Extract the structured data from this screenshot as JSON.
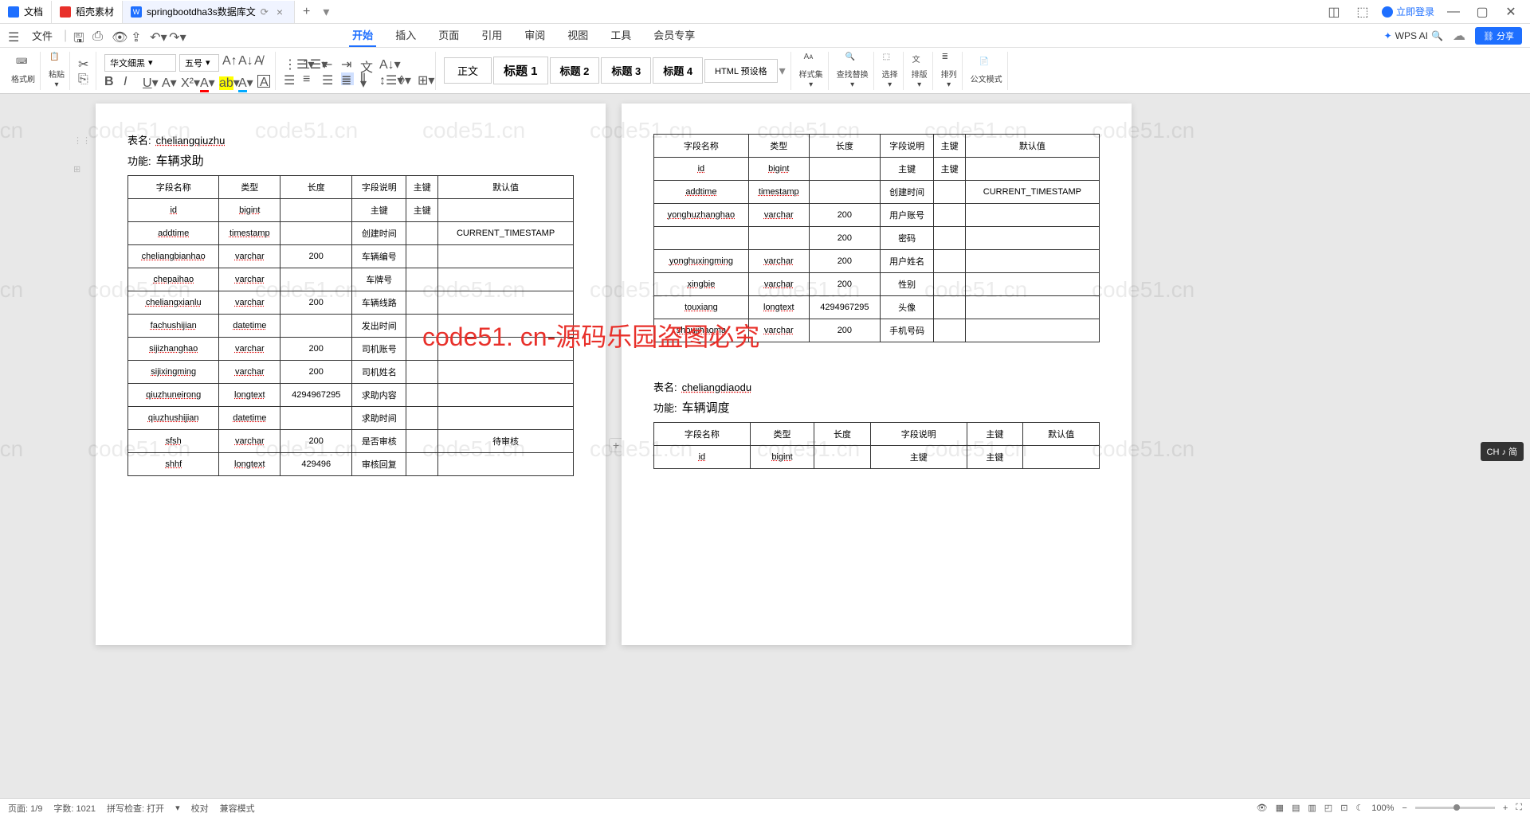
{
  "tabs": [
    {
      "label": "文档",
      "icon_color": "#1e6fff"
    },
    {
      "label": "稻壳素材",
      "icon_color": "#e8302a"
    },
    {
      "label": "springbootdha3s数据库文",
      "icon_color": "#1e6fff",
      "active": true
    }
  ],
  "login_label": "立即登录",
  "file_menu": "文件",
  "menu_tabs": [
    "开始",
    "插入",
    "页面",
    "引用",
    "审阅",
    "视图",
    "工具",
    "会员专享"
  ],
  "active_menu": "开始",
  "wps_ai": "WPS AI",
  "share": "分享",
  "ribbon": {
    "format_painter": "格式刷",
    "paste": "粘贴",
    "font_name": "华文细黑",
    "font_size": "五号",
    "styles": {
      "body": "正文",
      "h1": "标题 1",
      "h2": "标题 2",
      "h3": "标题 3",
      "h4": "标题 4",
      "html": "HTML 预设格"
    },
    "stylegroup": "样式集",
    "findreplace": "查找替换",
    "select": "选择",
    "vertical": "排版",
    "arrange": "排列",
    "gov": "公文模式"
  },
  "watermark_text": "code51.cn",
  "wm_red": "code51. cn-源码乐园盗图必究",
  "page1": {
    "table_name_label": "表名:",
    "table_name": "cheliangqiuzhu",
    "func_label": "功能:",
    "func": "车辆求助",
    "headers": [
      "字段名称",
      "类型",
      "长度",
      "字段说明",
      "主键",
      "默认值"
    ],
    "rows": [
      [
        "id",
        "bigint",
        "",
        "主键",
        "主键",
        ""
      ],
      [
        "addtime",
        "timestamp",
        "",
        "创建时间",
        "",
        "CURRENT_TIMESTAMP"
      ],
      [
        "cheliangbianhao",
        "varchar",
        "200",
        "车辆编号",
        "",
        ""
      ],
      [
        "chepaihao",
        "varchar",
        "",
        "车牌号",
        "",
        ""
      ],
      [
        "cheliangxianlu",
        "varchar",
        "200",
        "车辆线路",
        "",
        ""
      ],
      [
        "fachushijian",
        "datetime",
        "",
        "发出时间",
        "",
        ""
      ],
      [
        "sijizhanghao",
        "varchar",
        "200",
        "司机账号",
        "",
        ""
      ],
      [
        "sijixingming",
        "varchar",
        "200",
        "司机姓名",
        "",
        ""
      ],
      [
        "qiuzhuneirong",
        "longtext",
        "4294967295",
        "求助内容",
        "",
        ""
      ],
      [
        "qiuzhushijian",
        "datetime",
        "",
        "求助时间",
        "",
        ""
      ],
      [
        "sfsh",
        "varchar",
        "200",
        "是否审核",
        "",
        "待审核"
      ],
      [
        "shhf",
        "longtext",
        "429496",
        "审核回复",
        "",
        ""
      ]
    ]
  },
  "page2": {
    "headers": [
      "字段名称",
      "类型",
      "长度",
      "字段说明",
      "主键",
      "默认值"
    ],
    "rows1": [
      [
        "id",
        "bigint",
        "",
        "主键",
        "主键",
        ""
      ],
      [
        "addtime",
        "timestamp",
        "",
        "创建时间",
        "",
        "CURRENT_TIMESTAMP"
      ],
      [
        "yonghuzhanghao",
        "varchar",
        "200",
        "用户账号",
        "",
        ""
      ],
      [
        "",
        "",
        "200",
        "密码",
        "",
        ""
      ],
      [
        "yonghuxingming",
        "varchar",
        "200",
        "用户姓名",
        "",
        ""
      ],
      [
        "xingbie",
        "varchar",
        "200",
        "性别",
        "",
        ""
      ],
      [
        "touxiang",
        "longtext",
        "4294967295",
        "头像",
        "",
        ""
      ],
      [
        "shoujihaoma",
        "varchar",
        "200",
        "手机号码",
        "",
        ""
      ]
    ],
    "table_name_label": "表名:",
    "table_name": "cheliangdiaodu",
    "func_label": "功能:",
    "func": "车辆调度",
    "rows2": [
      [
        "id",
        "bigint",
        "",
        "主键",
        "主键",
        ""
      ]
    ]
  },
  "status": {
    "page": "页面: 1/9",
    "words": "字数: 1021",
    "spell": "拼写检查: 打开",
    "proof": "校对",
    "compat": "兼容模式",
    "zoom": "100%"
  },
  "ime": "CH ♪ 简"
}
